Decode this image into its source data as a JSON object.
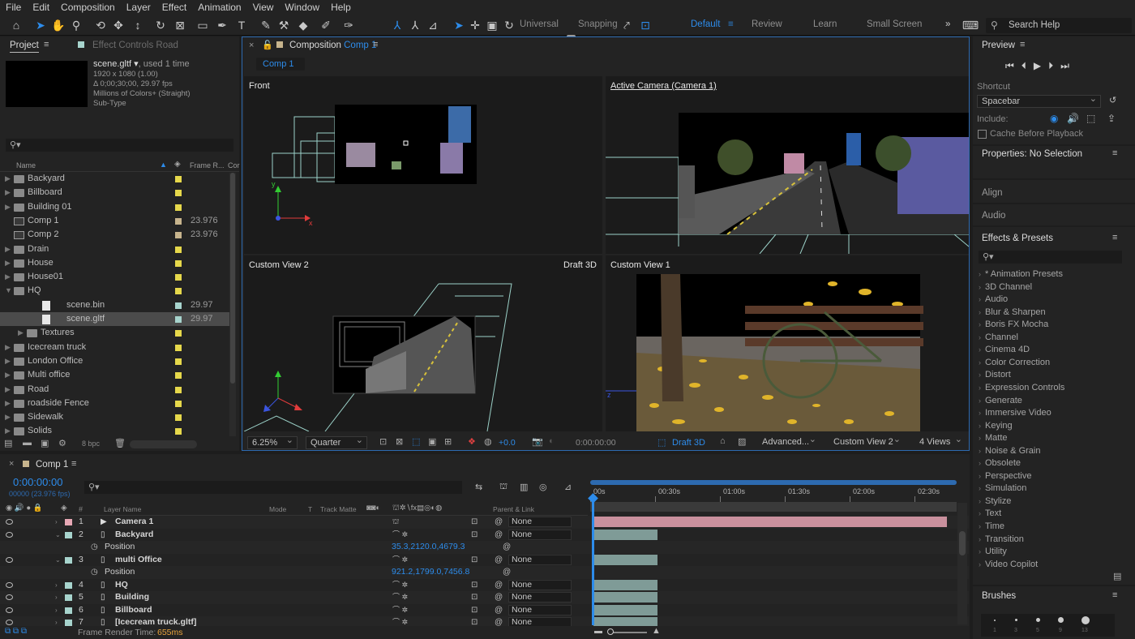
{
  "menu": [
    "File",
    "Edit",
    "Composition",
    "Layer",
    "Effect",
    "Animation",
    "View",
    "Window",
    "Help"
  ],
  "toolbar": {
    "axis_mode": "Universal",
    "snapping": "Snapping",
    "search_placeholder": "Search Help"
  },
  "workspaces": [
    "Default",
    "Review",
    "Learn",
    "Small Screen"
  ],
  "project_panel": {
    "tab_project": "Project",
    "tab_effect_controls": "Effect Controls Road",
    "info": {
      "name": "scene.gltf",
      "used": ", used 1 time",
      "size": "1920 x 1080 (1.00)",
      "duration": "Δ 0;00;30;00, 29.97 fps",
      "colors": "Millions of Colors+ (Straight)",
      "subtype": "Sub-Type"
    },
    "columns": {
      "name": "Name",
      "frame_rate": "Frame R...",
      "comment": "Cor"
    },
    "items": [
      {
        "name": "Backyard",
        "type": "folder",
        "indent": 0,
        "label_color": "#e6d84b",
        "fps": ""
      },
      {
        "name": "Billboard",
        "type": "folder",
        "indent": 0,
        "label_color": "#e6d84b",
        "fps": ""
      },
      {
        "name": "Building 01",
        "type": "folder",
        "indent": 0,
        "label_color": "#e6d84b",
        "fps": ""
      },
      {
        "name": "Comp 1",
        "type": "comp",
        "indent": 0,
        "label_color": "#c7b48d",
        "fps": "23.976"
      },
      {
        "name": "Comp 2",
        "type": "comp",
        "indent": 0,
        "label_color": "#c7b48d",
        "fps": "23.976"
      },
      {
        "name": "Drain",
        "type": "folder",
        "indent": 0,
        "label_color": "#e6d84b",
        "fps": ""
      },
      {
        "name": "House",
        "type": "folder",
        "indent": 0,
        "label_color": "#e6d84b",
        "fps": ""
      },
      {
        "name": "House01",
        "type": "folder",
        "indent": 0,
        "label_color": "#e6d84b",
        "fps": ""
      },
      {
        "name": "HQ",
        "type": "folder-open",
        "indent": 0,
        "label_color": "#e6d84b",
        "fps": ""
      },
      {
        "name": "scene.bin",
        "type": "file",
        "indent": 2,
        "label_color": "#a7d4cd",
        "fps": "29.97"
      },
      {
        "name": "scene.gltf",
        "type": "file",
        "indent": 2,
        "label_color": "#a7d4cd",
        "fps": "29.97",
        "selected": true
      },
      {
        "name": "Textures",
        "type": "folder",
        "indent": 1,
        "label_color": "#e6d84b",
        "fps": ""
      },
      {
        "name": "Icecream truck",
        "type": "folder",
        "indent": 0,
        "label_color": "#e6d84b",
        "fps": ""
      },
      {
        "name": "London Office",
        "type": "folder",
        "indent": 0,
        "label_color": "#e6d84b",
        "fps": ""
      },
      {
        "name": "Multi office",
        "type": "folder",
        "indent": 0,
        "label_color": "#e6d84b",
        "fps": ""
      },
      {
        "name": "Road",
        "type": "folder",
        "indent": 0,
        "label_color": "#e6d84b",
        "fps": ""
      },
      {
        "name": "roadside Fence",
        "type": "folder",
        "indent": 0,
        "label_color": "#e6d84b",
        "fps": ""
      },
      {
        "name": "Sidewalk",
        "type": "folder",
        "indent": 0,
        "label_color": "#e6d84b",
        "fps": ""
      },
      {
        "name": "Solids",
        "type": "folder",
        "indent": 0,
        "label_color": "#e6d84b",
        "fps": ""
      }
    ],
    "bpc": "8 bpc"
  },
  "composition": {
    "tab_prefix": "Composition",
    "tab_name": "Comp 1",
    "sub_tab": "Comp 1",
    "views": {
      "front": "Front",
      "active": "Active Camera (Camera 1)",
      "custom2": "Custom View 2",
      "custom1": "Custom View 1",
      "draft_label": "Draft 3D"
    },
    "footer": {
      "zoom": "6.25%",
      "quality": "Quarter",
      "exposure": "+0.0",
      "timecode": "0:00:00:00",
      "draft": "Draft 3D",
      "renderer": "Advanced...",
      "view": "Custom View 2",
      "layout": "4 Views"
    }
  },
  "right_panel": {
    "preview": "Preview",
    "shortcut": "Shortcut",
    "shortcut_value": "Spacebar",
    "include": "Include:",
    "cache": "Cache Before Playback",
    "properties": "Properties: No Selection",
    "align": "Align",
    "audio": "Audio",
    "effects": "Effects & Presets",
    "effects_list": [
      "* Animation Presets",
      "3D Channel",
      "Audio",
      "Blur & Sharpen",
      "Boris FX Mocha",
      "Channel",
      "Cinema 4D",
      "Color Correction",
      "Distort",
      "Expression Controls",
      "Generate",
      "Immersive Video",
      "Keying",
      "Matte",
      "Noise & Grain",
      "Obsolete",
      "Perspective",
      "Simulation",
      "Stylize",
      "Text",
      "Time",
      "Transition",
      "Utility",
      "Video Copilot"
    ],
    "brushes": "Brushes",
    "brush_sizes": [
      "1",
      "3",
      "5",
      "9",
      "13"
    ]
  },
  "timeline": {
    "tab": "Comp 1",
    "timecode": "0:00:00:00",
    "fps": "00000 (23.976 fps)",
    "headers": {
      "layer_name": "Layer Name",
      "mode": "Mode",
      "t": "T",
      "track_matte": "Track Matte",
      "parent": "Parent & Link"
    },
    "ruler": [
      "00s",
      "00:30s",
      "01:00s",
      "01:30s",
      "02:00s",
      "02:30s"
    ],
    "rows": [
      {
        "kind": "layer",
        "num": "1",
        "name": "Camera 1",
        "label_color": "#e7a8b5",
        "parent": "None",
        "bar_color": "#c9909d",
        "bar_end": 0.99,
        "icon": "camera"
      },
      {
        "kind": "layer",
        "num": "2",
        "name": "Backyard",
        "label_color": "#a7d4cd",
        "parent": "None",
        "bar_color": "#7f9b97",
        "bar_end": 0.18,
        "expanded": true
      },
      {
        "kind": "prop",
        "name": "Position",
        "value": "35.3,2120.0,4679.3"
      },
      {
        "kind": "layer",
        "num": "3",
        "name": "multi Office",
        "label_color": "#a7d4cd",
        "parent": "None",
        "bar_color": "#7f9b97",
        "bar_end": 0.18,
        "expanded": true
      },
      {
        "kind": "prop",
        "name": "Position",
        "value": "921.2,1799.0,7456.8"
      },
      {
        "kind": "layer",
        "num": "4",
        "name": "HQ",
        "label_color": "#a7d4cd",
        "parent": "None",
        "bar_color": "#7f9b97",
        "bar_end": 0.18
      },
      {
        "kind": "layer",
        "num": "5",
        "name": "Building",
        "label_color": "#a7d4cd",
        "parent": "None",
        "bar_color": "#7f9b97",
        "bar_end": 0.18
      },
      {
        "kind": "layer",
        "num": "6",
        "name": "Billboard",
        "label_color": "#a7d4cd",
        "parent": "None",
        "bar_color": "#7f9b97",
        "bar_end": 0.18
      },
      {
        "kind": "layer",
        "num": "7",
        "name": "[Icecream truck.gltf]",
        "label_color": "#a7d4cd",
        "parent": "None",
        "bar_color": "#7f9b97",
        "bar_end": 0.18
      }
    ],
    "frame_render_label": "Frame Render Time:",
    "frame_render_value": "655ms"
  },
  "colors": {
    "accent": "#2d8ceb",
    "panel_bg": "#232323",
    "app_bg": "#1d1d1d",
    "selected_row": "#4b4b4b",
    "orange": "#e8a33d"
  }
}
